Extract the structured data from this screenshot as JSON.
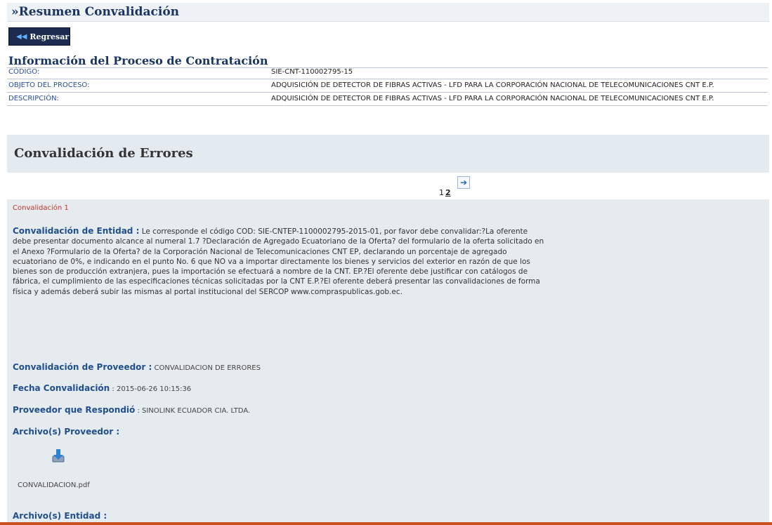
{
  "page": {
    "title": "»Resumen Convalidación"
  },
  "toolbar": {
    "back_label": "Regresar"
  },
  "process_info": {
    "title": "Información del Proceso de Contratación",
    "rows": [
      {
        "label": "CÓDIGO:",
        "value": "SIE-CNT-110002795-15"
      },
      {
        "label": "OBJETO DEL PROCESO:",
        "value": "ADQUISICIÓN DE DETECTOR DE FIBRAS ACTIVAS - LFD PARA LA CORPORACIÓN NACIONAL DE TELECOMUNICACIONES CNT E.P."
      },
      {
        "label": "DESCRIPCIÓN:",
        "value": "ADQUISICIÓN DE DETECTOR DE FIBRAS ACTIVAS - LFD PARA LA CORPORACIÓN NACIONAL DE TELECOMUNICACIONES CNT E.P."
      }
    ]
  },
  "section": {
    "title": "Convalidación de Errores"
  },
  "pagination": {
    "pages": [
      "1",
      "2"
    ],
    "current": "2",
    "next_icon": "arrow-right-icon"
  },
  "convalidation": {
    "number_label": "Convalidación 1",
    "entity_label": "Convalidación de Entidad :",
    "entity_text": " Le corresponde el código COD: SIE-CNTEP-1100002795-2015-01, por favor debe convalidar:?La oferente debe presentar documento alcance al numeral 1.7 ?Declaración de Agregado Ecuatoriano de la Oferta? del formulario de la oferta solicitado en el Anexo ?Formulario de la Oferta? de la Corporación Nacional de Telecomunicaciones CNT EP, declarando un porcentaje de agregado ecuatoriano de 0%, e indicando en el punto No. 6 que NO va a importar directamente los bienes y servicios del exterior en razón de que los bienes son de producción extranjera, pues la importación se efectuará a nombre de la CNT. EP.?El oferente debe justificar con catálogos de fábrica, el cumplimiento de las especificaciones técnicas solicitadas por la CNT E.P.?El oferente deberá presentar las convalidaciones de forma física y además deberá subir las mismas al portal institucional del SERCOP www.compraspublicas.gob.ec.",
    "provider_label": "Convalidación de Proveedor :",
    "provider_value": " CONVALIDACION DE ERRORES",
    "date_label": "Fecha Convalidación",
    "date_value": " : 2015-06-26 10:15:36",
    "responder_label": "Proveedor que Respondió",
    "responder_value": " : SINOLINK ECUADOR CIA. LTDA.",
    "provider_files_label": "Archivo(s) Proveedor :",
    "provider_files": [
      {
        "name": "CONVALIDACION.pdf",
        "icon": "download-icon"
      }
    ],
    "entity_files_label": "Archivo(s) Entidad :"
  },
  "colors": {
    "title": "#1a3565",
    "accent_label": "#1f4f8f",
    "number": "#c0392b",
    "band": "#e3eaf0",
    "content_bg": "#e6ebf0"
  }
}
